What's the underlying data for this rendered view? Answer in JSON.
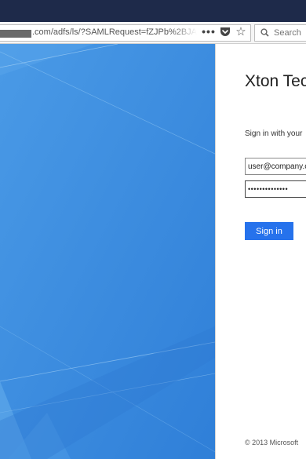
{
  "browser": {
    "url": ".com/adfs/ls/?SAMLRequest=fZJPb%2BJA",
    "search": {
      "placeholder": "Search"
    }
  },
  "login": {
    "org_name": "Xton Tec",
    "signin_hint": "Sign in with your",
    "email_value": "user@company.com",
    "password_value": "••••••••••••••",
    "signin_button": "Sign in",
    "copyright": "© 2013 Microsoft"
  },
  "colors": {
    "hero_blue": "#3f8fe0",
    "button_blue": "#2672ec",
    "title_bar": "#1e2a4a"
  },
  "icons": {
    "toolbar": [
      "more-icon",
      "pocket-icon",
      "star-icon",
      "search-icon"
    ]
  }
}
